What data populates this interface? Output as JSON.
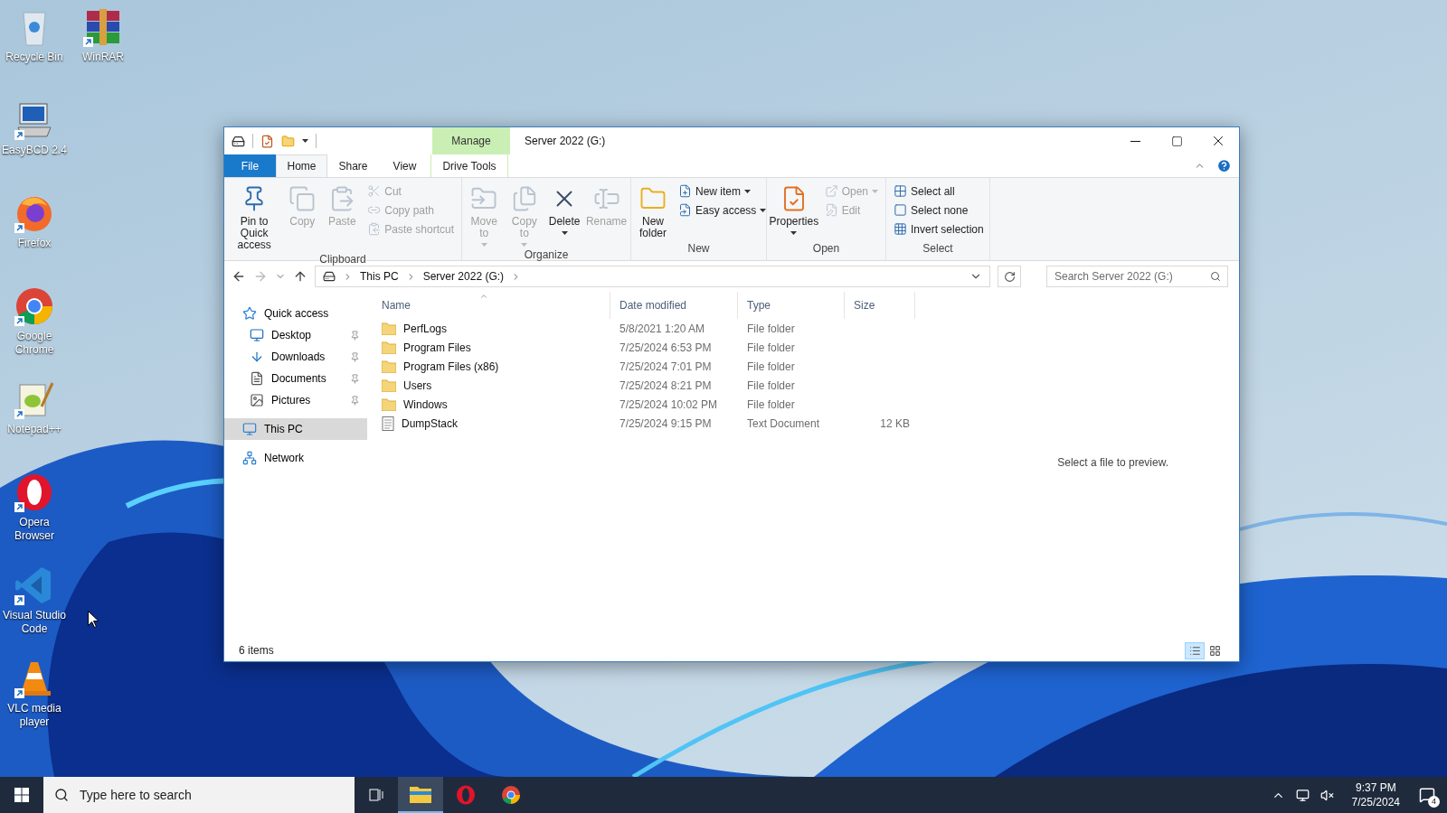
{
  "desktop_icons": [
    {
      "label": "Recycle Bin",
      "kind": "bin",
      "shortcut": false
    },
    {
      "label": "WinRAR",
      "kind": "winrar",
      "shortcut": true
    },
    {
      "label": "EasyBCD 2.4",
      "kind": "easybcd",
      "shortcut": true
    },
    {
      "label": "Firefox",
      "kind": "firefox",
      "shortcut": true
    },
    {
      "label": "Google Chrome",
      "kind": "chrome",
      "shortcut": true
    },
    {
      "label": "Notepad++",
      "kind": "notepad",
      "shortcut": true
    },
    {
      "label": "Opera Browser",
      "kind": "opera",
      "shortcut": true
    },
    {
      "label": "Visual Studio Code",
      "kind": "vscode",
      "shortcut": true
    },
    {
      "label": "VLC media player",
      "kind": "vlc",
      "shortcut": true
    }
  ],
  "window": {
    "title": "Server 2022 (G:)",
    "context_group": "Manage",
    "tabs": [
      {
        "label": "File",
        "kind": "file",
        "selected": false
      },
      {
        "label": "Home",
        "kind": "tab",
        "selected": true
      },
      {
        "label": "Share",
        "kind": "tab",
        "selected": false
      },
      {
        "label": "View",
        "kind": "tab",
        "selected": false
      },
      {
        "label": "Drive Tools",
        "kind": "context",
        "selected": false
      }
    ],
    "ribbon": {
      "groups": [
        {
          "label": "Clipboard",
          "buttons": [
            {
              "label": "Pin to Quick access",
              "kind": "large",
              "disabled": false,
              "dropdown": false
            },
            {
              "label": "Copy",
              "kind": "large",
              "disabled": true,
              "dropdown": false
            },
            {
              "label": "Paste",
              "kind": "large",
              "disabled": true,
              "dropdown": false
            },
            {
              "label": "Cut",
              "kind": "small",
              "disabled": true,
              "dropdown": false
            },
            {
              "label": "Copy path",
              "kind": "small",
              "disabled": true,
              "dropdown": false
            },
            {
              "label": "Paste shortcut",
              "kind": "small",
              "disabled": true,
              "dropdown": false
            }
          ]
        },
        {
          "label": "Organize",
          "buttons": [
            {
              "label": "Move to",
              "kind": "large",
              "disabled": true,
              "dropdown": true
            },
            {
              "label": "Copy to",
              "kind": "large",
              "disabled": true,
              "dropdown": true
            },
            {
              "label": "Delete",
              "kind": "large",
              "disabled": false,
              "dropdown": true
            },
            {
              "label": "Rename",
              "kind": "large",
              "disabled": true,
              "dropdown": false
            }
          ]
        },
        {
          "label": "New",
          "buttons": [
            {
              "label": "New folder",
              "kind": "large",
              "disabled": false,
              "dropdown": false
            },
            {
              "label": "New item",
              "kind": "small",
              "disabled": false,
              "dropdown": true
            },
            {
              "label": "Easy access",
              "kind": "small",
              "disabled": false,
              "dropdown": true
            }
          ]
        },
        {
          "label": "Open",
          "buttons": [
            {
              "label": "Properties",
              "kind": "large",
              "disabled": false,
              "dropdown": true
            },
            {
              "label": "Open",
              "kind": "small",
              "disabled": true,
              "dropdown": true
            },
            {
              "label": "Edit",
              "kind": "small",
              "disabled": true,
              "dropdown": false
            }
          ]
        },
        {
          "label": "Select",
          "buttons": [
            {
              "label": "Select all",
              "kind": "small",
              "disabled": false,
              "dropdown": false
            },
            {
              "label": "Select none",
              "kind": "small",
              "disabled": false,
              "dropdown": false
            },
            {
              "label": "Invert selection",
              "kind": "small",
              "disabled": false,
              "dropdown": false
            }
          ]
        }
      ]
    },
    "address": {
      "crumbs": [
        "This PC",
        "Server 2022 (G:)"
      ],
      "search_placeholder": "Search Server 2022 (G:)"
    },
    "nav_pane": {
      "items": [
        {
          "label": "Quick access",
          "kind": "star",
          "selected": false,
          "children": [
            {
              "label": "Desktop",
              "kind": "desktop",
              "pinned": true
            },
            {
              "label": "Downloads",
              "kind": "download",
              "pinned": true
            },
            {
              "label": "Documents",
              "kind": "document",
              "pinned": true
            },
            {
              "label": "Pictures",
              "kind": "pictures",
              "pinned": true
            }
          ]
        },
        {
          "label": "This PC",
          "kind": "pc",
          "selected": true
        },
        {
          "label": "Network",
          "kind": "network",
          "selected": false
        }
      ]
    },
    "file_list": {
      "columns": [
        {
          "label": "Name",
          "sorted": true
        },
        {
          "label": "Date modified",
          "sorted": false
        },
        {
          "label": "Type",
          "sorted": false
        },
        {
          "label": "Size",
          "sorted": false
        }
      ],
      "rows": [
        {
          "name": "PerfLogs",
          "date": "5/8/2021 1:20 AM",
          "type": "File folder",
          "kind": "folder"
        },
        {
          "name": "Program Files",
          "date": "7/25/2024 6:53 PM",
          "type": "File folder",
          "kind": "folder"
        },
        {
          "name": "Program Files (x86)",
          "date": "7/25/2024 7:01 PM",
          "type": "File folder",
          "kind": "folder"
        },
        {
          "name": "Users",
          "date": "7/25/2024 8:21 PM",
          "type": "File folder",
          "kind": "folder"
        },
        {
          "name": "Windows",
          "date": "7/25/2024 10:02 PM",
          "type": "File folder",
          "kind": "folder"
        },
        {
          "name": "DumpStack",
          "date": "7/25/2024 9:15 PM",
          "type": "Text Document",
          "size": "12 KB",
          "kind": "text"
        }
      ]
    },
    "preview_message": "Select a file to preview.",
    "status": "6 items",
    "view_buttons": [
      {
        "kind": "details",
        "selected": true
      },
      {
        "kind": "large",
        "selected": false
      }
    ]
  },
  "taskbar": {
    "search_placeholder": "Type here to search",
    "apps": [
      {
        "kind": "explorer",
        "active": true
      },
      {
        "kind": "opera",
        "active": false
      },
      {
        "kind": "chrome",
        "active": false
      }
    ],
    "time": "9:37 PM",
    "date": "7/25/2024",
    "notifications": "4"
  }
}
